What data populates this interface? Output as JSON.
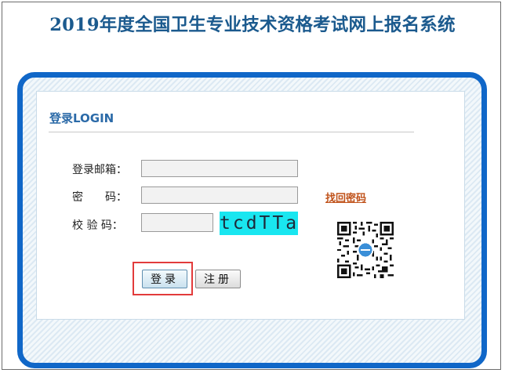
{
  "header": {
    "title": "2019年度全国卫生专业技术资格考试网上报名系统"
  },
  "login": {
    "heading": "登录LOGIN",
    "email_label": "登录邮箱：",
    "password_label": "密　　码：",
    "captcha_label": "校 验 码：",
    "email_value": "",
    "password_value": "",
    "captcha_value": "",
    "captcha_image_text": "tcdTTa",
    "forgot_password": "找回密码",
    "login_button": "登录",
    "register_button": "注册"
  },
  "colors": {
    "title": "#1b5a8e",
    "frame_border": "#1067c8",
    "link": "#c0521a",
    "captcha_bg": "#19e6f0",
    "highlight": "#e23b3b"
  },
  "icons": {
    "qr": "qr-code-icon"
  }
}
